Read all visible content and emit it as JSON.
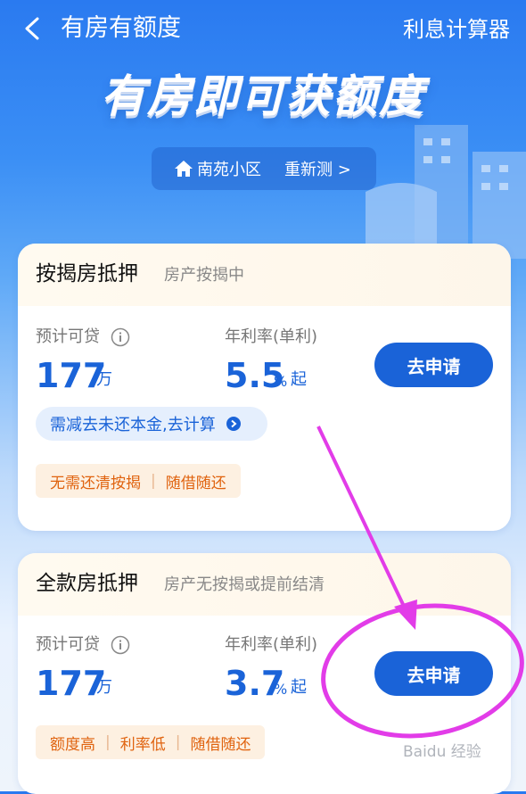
{
  "header": {
    "title": "有房有额度",
    "calculator": "利息计算器"
  },
  "hero": {
    "title": "有房即可获额度"
  },
  "location": {
    "name": "南苑小区",
    "retest": "重新测 >"
  },
  "cards": [
    {
      "title": "按揭房抵押",
      "subtitle": "房产按揭中",
      "loan_label": "预计可贷",
      "loan_amount": "177",
      "loan_unit": "万",
      "rate_label": "年利率(单利)",
      "rate_value": "5.5",
      "rate_unit": "%",
      "rate_suffix": "起",
      "apply_label": "去申请",
      "calc_link": "需减去未还本金,去计算",
      "tags": [
        "无需还清按揭",
        "随借随还"
      ]
    },
    {
      "title": "全款房抵押",
      "subtitle": "房产无按揭或提前结清",
      "loan_label": "预计可贷",
      "loan_amount": "177",
      "loan_unit": "万",
      "rate_label": "年利率(单利)",
      "rate_value": "3.7",
      "rate_unit": "%",
      "rate_suffix": "起",
      "apply_label": "去申请",
      "tags": [
        "额度高",
        "利率低",
        "随借随还"
      ]
    }
  ],
  "watermark": {
    "text": "Baidu 经验"
  },
  "colors": {
    "accent": "#1a63d8",
    "tag_text": "#e0630f",
    "annotation": "#e23ce8"
  }
}
